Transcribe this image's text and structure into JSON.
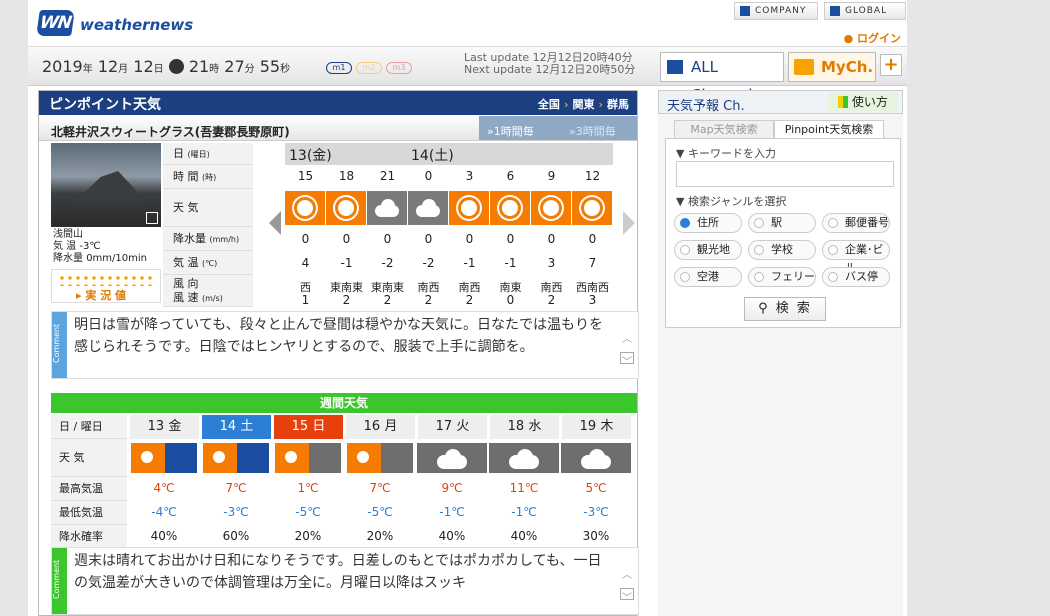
{
  "header": {
    "logo_mark": "WN",
    "logo_text": "weathernews",
    "company": "COMPANY",
    "global": "GLOBAL",
    "login": "ログイン"
  },
  "datebar": {
    "year": "2019",
    "month": "12",
    "day": "12",
    "time_h": "21",
    "time_m": "27",
    "time_s": "55",
    "pills": [
      "m1",
      "m2",
      "m3"
    ],
    "last_update": "Last update 12月12日20時40分",
    "next_update": "Next update 12月12日20時50分",
    "all_channel": "ALL Channel",
    "mych": "MyCh.",
    "plus": "+"
  },
  "main": {
    "title": "ピンポイント天気",
    "breadcrumb": [
      "全国",
      "関東",
      "群馬"
    ],
    "place": "北軽井沢スウィートグラス(吾妻郡長野原町)",
    "step1": "1時間毎",
    "step3": "3時間毎",
    "photo_caption": "浅間山",
    "temp_label": "気 温",
    "temp": "-3℃",
    "precip_label": "降水量",
    "precip": "0mm/10min",
    "jk_label": "実 況 値",
    "rows": {
      "date": "日",
      "date_s": "(曜日)",
      "time": "時 間",
      "time_s": "(時)",
      "weather": "天 気",
      "rain": "降水量",
      "rain_s": "(mm/h)",
      "temp": "気 温",
      "temp_s": "(℃)",
      "wind": "風 向",
      "wind2": "風 速",
      "wind_s": "(m/s)"
    },
    "days": [
      "13(金)",
      "14(土)"
    ],
    "hours": [
      "15",
      "18",
      "21",
      "0",
      "3",
      "6",
      "9",
      "12"
    ],
    "weather": [
      "sun",
      "sun",
      "cloud",
      "cloud",
      "sun",
      "sun",
      "sun",
      "sun"
    ],
    "rain": [
      "0",
      "0",
      "0",
      "0",
      "0",
      "0",
      "0",
      "0"
    ],
    "temps": [
      "4",
      "-1",
      "-2",
      "-2",
      "-1",
      "-1",
      "3",
      "7"
    ],
    "wdir": [
      "西",
      "東南東",
      "東南東",
      "南西",
      "南西",
      "南東",
      "南西",
      "西南西"
    ],
    "wspd": [
      "1",
      "2",
      "2",
      "2",
      "2",
      "0",
      "2",
      "3"
    ],
    "comment": "明日は雪が降っていても、段々と止んで昼間は穏やかな天気に。日なたでは温もりを感じられそうです。日陰ではヒンヤリとするので、服装で上手に調節を。",
    "comment_tag": "Comment"
  },
  "weekly": {
    "title": "週間天気",
    "row_date": "日 / 曜日",
    "row_weather": "天 気",
    "row_max": "最高気温",
    "row_min": "最低気温",
    "row_rain": "降水確率",
    "days": [
      "13 金",
      "14 土",
      "15 日",
      "16 月",
      "17 火",
      "18 水",
      "19 木"
    ],
    "weather": [
      "sun-snow",
      "sun-snow",
      "sun-cloud",
      "sun-cloud",
      "cloud",
      "cloud",
      "cloud"
    ],
    "max": [
      "4℃",
      "7℃",
      "1℃",
      "7℃",
      "9℃",
      "11℃",
      "5℃"
    ],
    "min": [
      "-4℃",
      "-3℃",
      "-5℃",
      "-5℃",
      "-1℃",
      "-1℃",
      "-3℃"
    ],
    "rain": [
      "40%",
      "60%",
      "20%",
      "20%",
      "40%",
      "40%",
      "30%"
    ],
    "comment": "週末は晴れてお出かけ日和になりそうです。日差しのもとではポカポカしても、一日の気温差が大きいので体調管理は万全に。月曜日以降はスッキ",
    "comment_tag": "Comment"
  },
  "side": {
    "title": "天気予報 Ch.",
    "help": "使い方",
    "tab_map": "Map天気検索",
    "tab_pinpoint": "Pinpoint天気検索",
    "kw_label": "▼ キーワードを入力",
    "genre_label": "▼ 検索ジャンルを選択",
    "genres": [
      "住所",
      "駅",
      "郵便番号",
      "観光地",
      "学校",
      "企業･ビル",
      "空港",
      "フェリー",
      "バス停"
    ],
    "search": "検 索"
  }
}
